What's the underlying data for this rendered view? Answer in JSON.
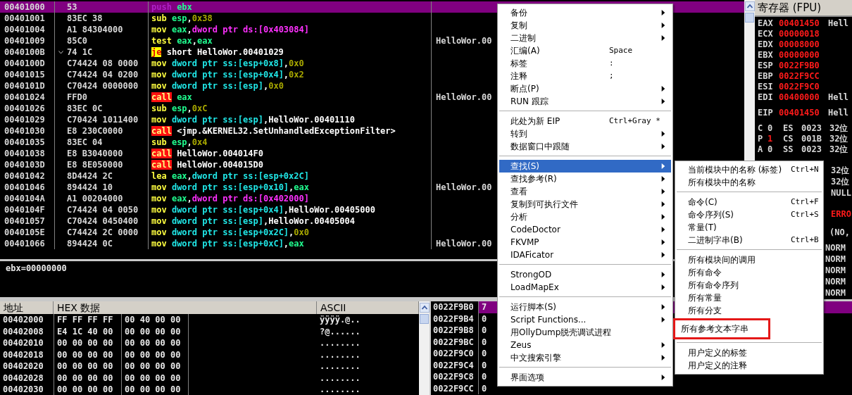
{
  "disassembly": {
    "rows": [
      {
        "address": "00401000",
        "hex": "53",
        "jump": false,
        "selected": true,
        "asm": [
          {
            "text": "push",
            "kind": "dim"
          },
          {
            "text": " ebx",
            "kind": "reg"
          }
        ]
      },
      {
        "address": "00401001",
        "hex": "83EC 38",
        "jump": false,
        "selected": false,
        "asm": [
          {
            "text": "sub",
            "kind": "mnem"
          },
          {
            "text": " esp",
            "kind": "reg"
          },
          {
            "text": ",",
            "kind": "plain"
          },
          {
            "text": "0x38",
            "kind": "num"
          }
        ]
      },
      {
        "address": "00401004",
        "hex": "A1 84304000",
        "jump": false,
        "selected": false,
        "asm": [
          {
            "text": "mov",
            "kind": "mnem"
          },
          {
            "text": " eax",
            "kind": "reg"
          },
          {
            "text": ",",
            "kind": "plain"
          },
          {
            "text": "dword ptr ds:[0x403084]",
            "kind": "ds"
          }
        ]
      },
      {
        "address": "00401009",
        "hex": "85C0",
        "jump": false,
        "selected": false,
        "comment": "HelloWor.00",
        "asm": [
          {
            "text": "test",
            "kind": "mnem"
          },
          {
            "text": " eax",
            "kind": "reg"
          },
          {
            "text": ",",
            "kind": "plain"
          },
          {
            "text": "eax",
            "kind": "reg"
          }
        ]
      },
      {
        "address": "0040100B",
        "hex": "74 1C",
        "jump": true,
        "selected": false,
        "asm": [
          {
            "text": "je",
            "kind": "jump"
          },
          {
            "text": " short HelloWor.00401029",
            "kind": "plain"
          }
        ]
      },
      {
        "address": "0040100D",
        "hex": "C74424 08 0000",
        "jump": false,
        "selected": false,
        "asm": [
          {
            "text": "mov",
            "kind": "mnem"
          },
          {
            "text": " dword ptr ss:[esp+0x8]",
            "kind": "ss"
          },
          {
            "text": ",",
            "kind": "plain"
          },
          {
            "text": "0x0",
            "kind": "num"
          }
        ]
      },
      {
        "address": "00401015",
        "hex": "C74424 04 0200",
        "jump": false,
        "selected": false,
        "asm": [
          {
            "text": "mov",
            "kind": "mnem"
          },
          {
            "text": " dword ptr ss:[esp+0x4]",
            "kind": "ss"
          },
          {
            "text": ",",
            "kind": "plain"
          },
          {
            "text": "0x2",
            "kind": "num"
          }
        ]
      },
      {
        "address": "0040101D",
        "hex": "C70424 0000000",
        "jump": false,
        "selected": false,
        "asm": [
          {
            "text": "mov",
            "kind": "mnem"
          },
          {
            "text": " dword ptr ss:[esp]",
            "kind": "ss"
          },
          {
            "text": ",",
            "kind": "plain"
          },
          {
            "text": "0x0",
            "kind": "num"
          }
        ]
      },
      {
        "address": "00401024",
        "hex": "FFD0",
        "jump": false,
        "selected": false,
        "comment": "HelloWor.00",
        "asm": [
          {
            "text": "call",
            "kind": "call"
          },
          {
            "text": " eax",
            "kind": "reg"
          }
        ]
      },
      {
        "address": "00401026",
        "hex": "83EC 0C",
        "jump": false,
        "selected": false,
        "asm": [
          {
            "text": "sub",
            "kind": "mnem"
          },
          {
            "text": " esp",
            "kind": "reg"
          },
          {
            "text": ",",
            "kind": "plain"
          },
          {
            "text": "0xC",
            "kind": "num"
          }
        ]
      },
      {
        "address": "00401029",
        "hex": "C70424 1011400",
        "jump": false,
        "selected": false,
        "asm": [
          {
            "text": "mov",
            "kind": "mnem"
          },
          {
            "text": " dword ptr ss:[esp]",
            "kind": "ss"
          },
          {
            "text": ",HelloWor.00401110",
            "kind": "plain"
          }
        ]
      },
      {
        "address": "00401030",
        "hex": "E8 230C0000",
        "jump": false,
        "selected": false,
        "asm": [
          {
            "text": "call",
            "kind": "call"
          },
          {
            "text": " <jmp.&KERNEL32.SetUnhandledExceptionFilter>",
            "kind": "plain"
          }
        ]
      },
      {
        "address": "00401035",
        "hex": "83EC 04",
        "jump": false,
        "selected": false,
        "asm": [
          {
            "text": "sub",
            "kind": "mnem"
          },
          {
            "text": " esp",
            "kind": "reg"
          },
          {
            "text": ",",
            "kind": "plain"
          },
          {
            "text": "0x4",
            "kind": "num"
          }
        ]
      },
      {
        "address": "00401038",
        "hex": "E8 B3040000",
        "jump": false,
        "selected": false,
        "asm": [
          {
            "text": "call",
            "kind": "call"
          },
          {
            "text": " HelloWor.004014F0",
            "kind": "plain"
          }
        ]
      },
      {
        "address": "0040103D",
        "hex": "E8 8E050000",
        "jump": false,
        "selected": false,
        "asm": [
          {
            "text": "call",
            "kind": "call"
          },
          {
            "text": " HelloWor.004015D0",
            "kind": "plain"
          }
        ]
      },
      {
        "address": "00401042",
        "hex": "8D4424 2C",
        "jump": false,
        "selected": false,
        "asm": [
          {
            "text": "lea",
            "kind": "mnem"
          },
          {
            "text": " eax",
            "kind": "reg"
          },
          {
            "text": ",",
            "kind": "plain"
          },
          {
            "text": "dword ptr ss:[esp+0x2C]",
            "kind": "ss"
          }
        ]
      },
      {
        "address": "00401046",
        "hex": "894424 10",
        "jump": false,
        "selected": false,
        "comment": "HelloWor.00",
        "asm": [
          {
            "text": "mov",
            "kind": "mnem"
          },
          {
            "text": " dword ptr ss:[esp+0x10]",
            "kind": "ss"
          },
          {
            "text": ",",
            "kind": "plain"
          },
          {
            "text": "eax",
            "kind": "reg"
          }
        ]
      },
      {
        "address": "0040104A",
        "hex": "A1 00204000",
        "jump": false,
        "selected": false,
        "asm": [
          {
            "text": "mov",
            "kind": "mnem"
          },
          {
            "text": " eax",
            "kind": "reg"
          },
          {
            "text": ",",
            "kind": "plain"
          },
          {
            "text": "dword ptr ds:[0x402000]",
            "kind": "ds"
          }
        ]
      },
      {
        "address": "0040104F",
        "hex": "C74424 04 0050",
        "jump": false,
        "selected": false,
        "asm": [
          {
            "text": "mov",
            "kind": "mnem"
          },
          {
            "text": " dword ptr ss:[esp+0x4]",
            "kind": "ss"
          },
          {
            "text": ",HelloWor.00405000",
            "kind": "plain"
          }
        ]
      },
      {
        "address": "00401057",
        "hex": "C70424 0450400",
        "jump": false,
        "selected": false,
        "asm": [
          {
            "text": "mov",
            "kind": "mnem"
          },
          {
            "text": " dword ptr ss:[esp]",
            "kind": "ss"
          },
          {
            "text": ",HelloWor.00405004",
            "kind": "plain"
          }
        ]
      },
      {
        "address": "0040105E",
        "hex": "C74424 2C 0000",
        "jump": false,
        "selected": false,
        "asm": [
          {
            "text": "mov",
            "kind": "mnem"
          },
          {
            "text": " dword ptr ss:[esp+0x2C]",
            "kind": "ss"
          },
          {
            "text": ",",
            "kind": "plain"
          },
          {
            "text": "0x0",
            "kind": "num"
          }
        ]
      },
      {
        "address": "00401066",
        "hex": "894424 0C",
        "jump": false,
        "selected": false,
        "comment": "HelloWor.00",
        "asm": [
          {
            "text": "mov",
            "kind": "mnem"
          },
          {
            "text": " dword ptr ss:[esp+0xC]",
            "kind": "ss"
          },
          {
            "text": ",",
            "kind": "plain"
          },
          {
            "text": "eax",
            "kind": "reg"
          }
        ]
      }
    ]
  },
  "info_pane": {
    "text": "ebx=00000000"
  },
  "registers": {
    "title": "寄存器 (FPU)",
    "groups": [
      [
        {
          "name": "EAX",
          "value": "00401450",
          "changed": true,
          "comment": "Hell"
        },
        {
          "name": "ECX",
          "value": "00000018",
          "changed": true
        },
        {
          "name": "EDX",
          "value": "00008000",
          "changed": true
        },
        {
          "name": "EBX",
          "value": "00000000",
          "changed": true
        },
        {
          "name": "ESP",
          "value": "0022F9B0",
          "changed": true
        },
        {
          "name": "EBP",
          "value": "0022F9CC",
          "changed": true
        },
        {
          "name": "ESI",
          "value": "0022F9C0",
          "changed": true
        },
        {
          "name": "EDI",
          "value": "00400000",
          "changed": true,
          "comment": "Hell"
        }
      ],
      [
        {
          "name": "EIP",
          "value": "00401450",
          "changed": true,
          "comment": "Hell"
        }
      ]
    ],
    "flags": [
      {
        "flag": "C",
        "value": "0",
        "changed": false,
        "segment": "ES",
        "selector": "0023",
        "info": "32位"
      },
      {
        "flag": "P",
        "value": "1",
        "changed": true,
        "segment": "CS",
        "selector": "001B",
        "info": "32位"
      },
      {
        "flag": "A",
        "value": "0",
        "changed": false,
        "segment": "SS",
        "selector": "0023",
        "info": "32位"
      }
    ],
    "flag_tails": [
      "32位",
      "32位",
      "NULL"
    ],
    "last_error": "ERRO",
    "error_code": "(NO,",
    "fpu_tags": [
      "NORM",
      "NORM",
      "NORM",
      "NORM",
      "NORM"
    ]
  },
  "dump": {
    "columns": [
      "地址",
      "HEX 数据",
      "ASCII"
    ],
    "rows": [
      {
        "address": "00402000",
        "bytes": [
          "FF FF FF FF",
          "00 40 00 00"
        ],
        "ascii": "ÿÿÿÿ.@.."
      },
      {
        "address": "00402008",
        "bytes": [
          "E4 1C 40 00",
          "00 00 00 00"
        ],
        "ascii": "?@......"
      },
      {
        "address": "00402010",
        "bytes": [
          "00 00 00 00",
          "00 00 00 00"
        ],
        "ascii": "........"
      },
      {
        "address": "00402018",
        "bytes": [
          "00 00 00 00",
          "00 00 00 00"
        ],
        "ascii": "........"
      },
      {
        "address": "00402020",
        "bytes": [
          "00 00 00 00",
          "00 00 00 00"
        ],
        "ascii": "........"
      },
      {
        "address": "00402028",
        "bytes": [
          "00 00 00 00",
          "00 00 00 00"
        ],
        "ascii": "........"
      },
      {
        "address": "00402030",
        "bytes": [
          "00 00 00 00",
          "00 00 00 00"
        ],
        "ascii": "........"
      }
    ]
  },
  "stack": {
    "rows": [
      {
        "address": "0022F9B0",
        "value": "7",
        "selected": true
      },
      {
        "address": "0022F9B4",
        "value": "0",
        "selected": false
      },
      {
        "address": "0022F9B8",
        "value": "0",
        "selected": false
      },
      {
        "address": "0022F9BC",
        "value": "0",
        "selected": false
      },
      {
        "address": "0022F9C0",
        "value": "0",
        "selected": false
      },
      {
        "address": "0022F9C4",
        "value": "0",
        "selected": false
      },
      {
        "address": "0022F9C8",
        "value": "0",
        "selected": false
      },
      {
        "address": "0022F9CC",
        "value": "0",
        "selected": false
      }
    ]
  },
  "context_menu": {
    "groups": [
      [
        {
          "label": "备份",
          "submenu": true,
          "selected": false
        },
        {
          "label": "复制",
          "submenu": true,
          "selected": false
        },
        {
          "label": "二进制",
          "submenu": true,
          "selected": false
        },
        {
          "label": "汇编(A)",
          "shortcut": "Space",
          "submenu": false,
          "selected": false
        },
        {
          "label": "标签",
          "shortcut": ":",
          "submenu": false,
          "selected": false
        },
        {
          "label": "注释",
          "shortcut": ";",
          "submenu": false,
          "selected": false
        },
        {
          "label": "断点(P)",
          "submenu": true,
          "selected": false
        },
        {
          "label": "RUN 跟踪",
          "submenu": true,
          "selected": false
        }
      ],
      [
        {
          "label": "此处为新 EIP",
          "shortcut": "Ctrl+Gray *",
          "submenu": false,
          "selected": false
        },
        {
          "label": "转到",
          "submenu": true,
          "selected": false
        },
        {
          "label": "数据窗口中跟随",
          "submenu": true,
          "selected": false
        }
      ],
      [
        {
          "label": "查找(S)",
          "submenu": true,
          "selected": true
        },
        {
          "label": "查找参考(R)",
          "submenu": true,
          "selected": false
        },
        {
          "label": "查看",
          "submenu": true,
          "selected": false
        },
        {
          "label": "复制到可执行文件",
          "submenu": true,
          "selected": false
        },
        {
          "label": "分析",
          "submenu": true,
          "selected": false
        },
        {
          "label": "CodeDoctor",
          "submenu": true,
          "selected": false
        },
        {
          "label": "FKVMP",
          "submenu": true,
          "selected": false
        },
        {
          "label": "IDAFicator",
          "submenu": true,
          "selected": false
        }
      ],
      [
        {
          "label": "StrongOD",
          "submenu": true,
          "selected": false
        },
        {
          "label": "LoadMapEx",
          "submenu": true,
          "selected": false
        }
      ],
      [
        {
          "label": "运行脚本(S)",
          "submenu": true,
          "selected": false
        },
        {
          "label": "Script Functions...",
          "submenu": true,
          "selected": false
        },
        {
          "label": "用OllyDump脱壳调试进程",
          "submenu": false,
          "selected": false
        },
        {
          "label": "Zeus",
          "submenu": true,
          "selected": false
        },
        {
          "label": "中文搜索引擎",
          "submenu": true,
          "selected": false
        }
      ],
      [
        {
          "label": "界面选项",
          "submenu": true,
          "selected": false
        }
      ]
    ]
  },
  "submenu": {
    "groups": [
      [
        {
          "label": "当前模块中的名称 (标签)",
          "shortcut": "Ctrl+N",
          "boxed": false
        },
        {
          "label": "所有模块中的名称",
          "boxed": false
        }
      ],
      [
        {
          "label": "命令(C)",
          "shortcut": "Ctrl+F",
          "boxed": false
        },
        {
          "label": "命令序列(S)",
          "shortcut": "Ctrl+S",
          "boxed": false
        },
        {
          "label": "常量(T)",
          "boxed": false
        },
        {
          "label": "二进制字串(B)",
          "shortcut": "Ctrl+B",
          "boxed": false
        }
      ],
      [
        {
          "label": "所有模块间的调用",
          "boxed": false
        },
        {
          "label": "所有命令",
          "boxed": false
        },
        {
          "label": "所有命令序列",
          "boxed": false
        },
        {
          "label": "所有常量",
          "boxed": false
        },
        {
          "label": "所有分支",
          "boxed": false
        },
        {
          "label": "所有参考文本字串",
          "boxed": true
        }
      ],
      [
        {
          "label": "用户定义的标签",
          "boxed": false
        },
        {
          "label": "用户定义的注释",
          "boxed": false
        }
      ]
    ]
  }
}
